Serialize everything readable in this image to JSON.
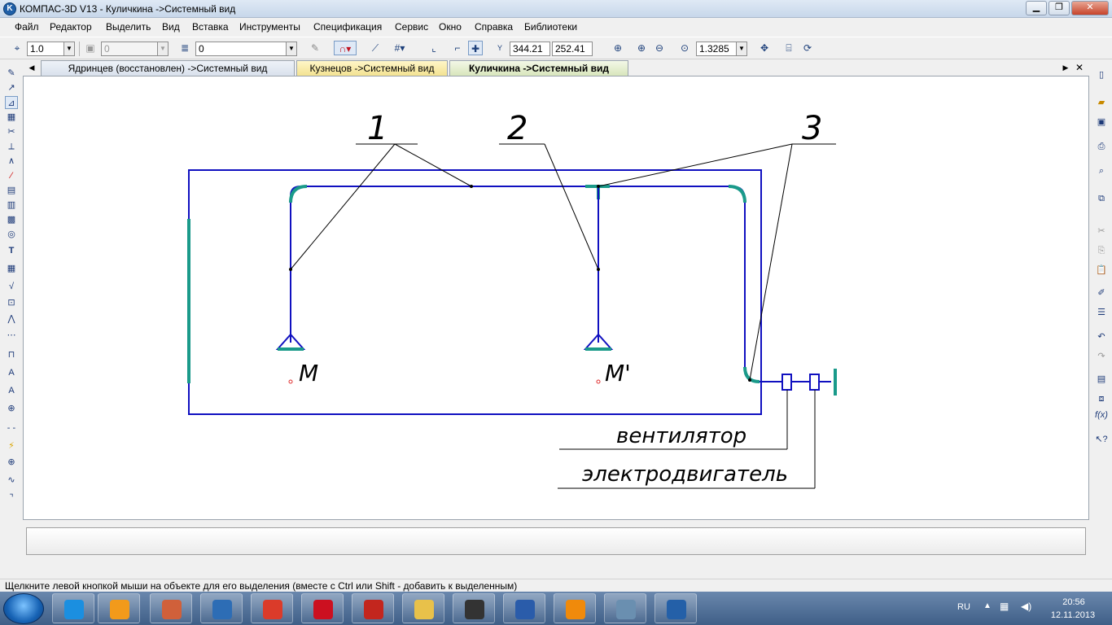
{
  "window": {
    "title": "КОМПАС-3D V13 - Куличкина ->Системный вид",
    "minimize_label": "▁",
    "maximize_label": "❐",
    "close_label": "✕"
  },
  "menu": [
    {
      "label": "Файл"
    },
    {
      "label": "Редактор"
    },
    {
      "label": "Выделить"
    },
    {
      "label": "Вид"
    },
    {
      "label": "Вставка"
    },
    {
      "label": "Инструменты"
    },
    {
      "label": "Спецификация"
    },
    {
      "label": "Сервис"
    },
    {
      "label": "Окно"
    },
    {
      "label": "Справка"
    },
    {
      "label": "Библиотеки"
    }
  ],
  "toolbar": {
    "line_width": "1.0",
    "layer_value": "0",
    "style_value": "0",
    "coord_x": "344.21",
    "coord_y": "252.41",
    "coord_x_label": "Y",
    "zoom_value": "1.3285"
  },
  "tabs": [
    {
      "label": "Ядринцев (восстановлен) ->Системный вид",
      "active": false
    },
    {
      "label": "Кузнецов ->Системный вид",
      "active": false
    },
    {
      "label": "Куличкина ->Системный вид",
      "active": true
    }
  ],
  "drawing": {
    "callout_1": "1",
    "callout_2": "2",
    "callout_3": "3",
    "label_m": "М",
    "label_m_prime": "М'",
    "label_fan": "вентилятор",
    "label_motor": "электродвигатель"
  },
  "status": {
    "message": "Щелкните левой кнопкой мыши на объекте для его выделения (вместе с Ctrl или Shift - добавить к выделенным)"
  },
  "taskbar": {
    "apps": [
      {
        "name": "internet-explorer-icon",
        "color": "#1b8fe0"
      },
      {
        "name": "media-player-icon",
        "color": "#f29a1b"
      },
      {
        "name": "presentation-icon",
        "color": "#d0603a"
      },
      {
        "name": "hp-icon",
        "color": "#2d6db5"
      },
      {
        "name": "chrome-icon",
        "color": "#db3b2a"
      },
      {
        "name": "opera-icon",
        "color": "#cc1020"
      },
      {
        "name": "pdf-icon",
        "color": "#c3261e"
      },
      {
        "name": "explorer-icon",
        "color": "#e8c14a"
      },
      {
        "name": "guitar-pro-icon",
        "color": "#333333"
      },
      {
        "name": "word-icon",
        "color": "#2a5caa"
      },
      {
        "name": "vlc-icon",
        "color": "#f08a0b"
      },
      {
        "name": "calculator-icon",
        "color": "#6a8fb0"
      },
      {
        "name": "kompas-icon",
        "color": "#2460a8"
      }
    ],
    "lang": "RU",
    "time": "20:56",
    "date": "12.11.2013"
  },
  "colors": {
    "line_blue": "#1010c0",
    "accent_teal": "#1a9a8a",
    "leader_black": "#000000"
  }
}
